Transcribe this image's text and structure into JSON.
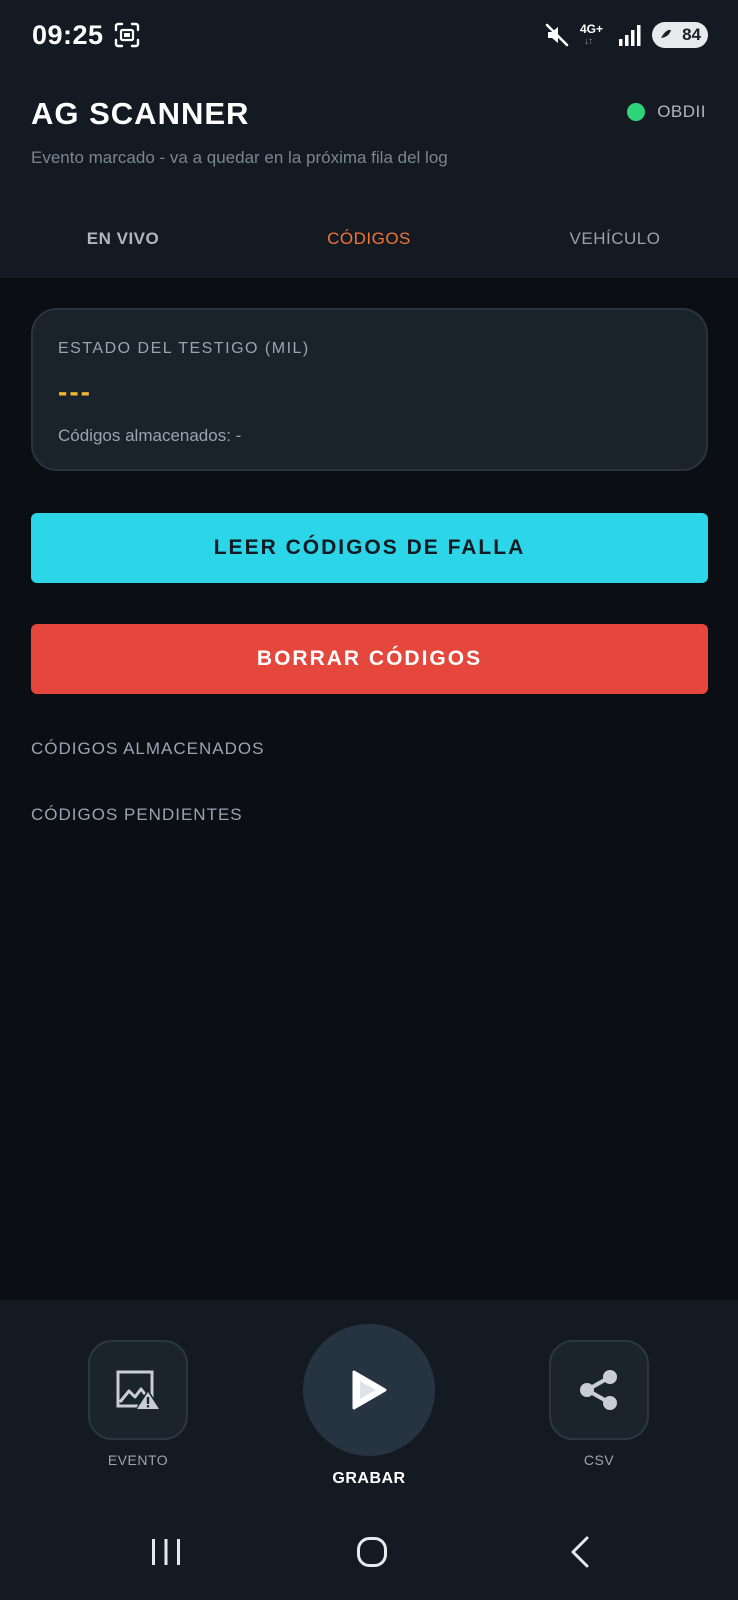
{
  "status_bar": {
    "time": "09:25",
    "network": "4G+",
    "battery": "84"
  },
  "header": {
    "title": "AG SCANNER",
    "connection_label": "OBDII",
    "connection_color": "#2fd57a",
    "subtitle": "Evento marcado - va a quedar en la próxima fila del log"
  },
  "tabs": [
    {
      "label": "EN VIVO"
    },
    {
      "label": "CÓDIGOS",
      "active": true
    },
    {
      "label": "VEHÍCULO"
    }
  ],
  "mil_card": {
    "heading": "ESTADO DEL TESTIGO (MIL)",
    "value": "---",
    "stored_codes": "Códigos almacenados: -"
  },
  "buttons": {
    "read_codes": "LEER CÓDIGOS DE FALLA",
    "clear_codes": "BORRAR CÓDIGOS"
  },
  "sections": {
    "stored": "CÓDIGOS ALMACENADOS",
    "pending": "CÓDIGOS PENDIENTES"
  },
  "actions": {
    "event": {
      "label": "EVENTO",
      "icon": "image-warning-icon"
    },
    "record": {
      "label": "GRABAR",
      "icon": "play-icon"
    },
    "csv": {
      "label": "CSV",
      "icon": "share-icon"
    }
  },
  "colors": {
    "accent_tab": "#f2733a",
    "read_button": "#2cd5e7",
    "clear_button": "#e5473d",
    "mil_value": "#f2b731"
  }
}
